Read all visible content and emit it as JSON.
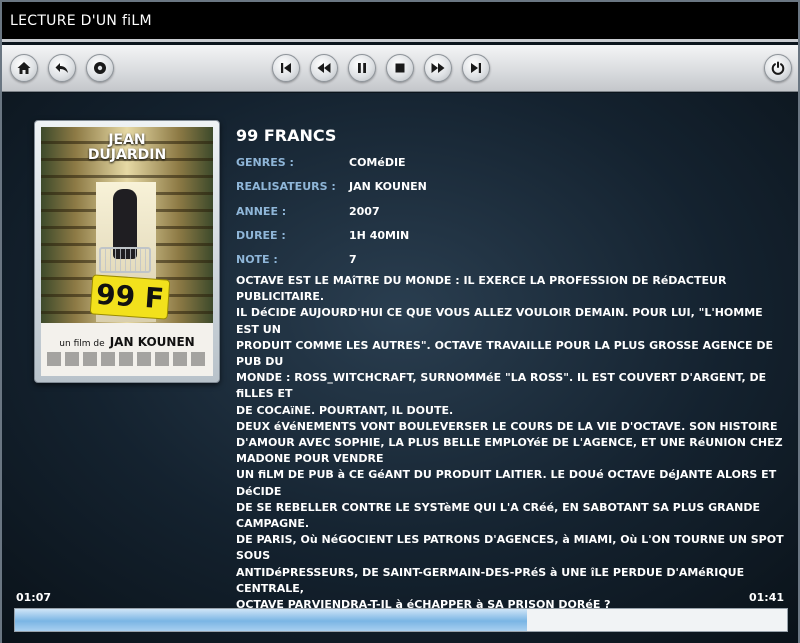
{
  "window": {
    "title": "LECTURE D'UN fiLM"
  },
  "toolbar": {
    "left": [
      {
        "id": "home",
        "icon": "home-icon"
      },
      {
        "id": "back",
        "icon": "back-arrow-icon"
      },
      {
        "id": "record",
        "icon": "disc-icon"
      }
    ],
    "center": [
      {
        "id": "skip-previous",
        "icon": "skip-previous-icon"
      },
      {
        "id": "rewind",
        "icon": "rewind-icon"
      },
      {
        "id": "pause",
        "icon": "pause-icon"
      },
      {
        "id": "stop",
        "icon": "stop-icon"
      },
      {
        "id": "fast-forward",
        "icon": "fast-forward-icon"
      },
      {
        "id": "skip-next",
        "icon": "skip-next-icon"
      }
    ],
    "right": [
      {
        "id": "power",
        "icon": "power-icon"
      }
    ]
  },
  "poster": {
    "actor_line1": "JEAN",
    "actor_line2": "DUJARDIN",
    "sticker": "99 F",
    "credit_prefix": "un film de",
    "director": "JAN KOUNEN"
  },
  "film": {
    "title": "99 FRANCS",
    "details": [
      {
        "label": "GENRES :",
        "value": "COMéDIE"
      },
      {
        "label": "REALISATEURS :",
        "value": "JAN KOUNEN"
      },
      {
        "label": "ANNEE :",
        "value": "2007"
      },
      {
        "label": "DUREE :",
        "value": "1H 40MIN"
      },
      {
        "label": "NOTE :",
        "value": "7"
      }
    ],
    "synopsis": [
      "OCTAVE EST LE MAîTRE DU MONDE : IL EXERCE LA PROFESSION DE RéDACTEUR PUBLICITAIRE.",
      "IL DéCIDE AUJOURD'HUI CE QUE VOUS ALLEZ VOULOIR DEMAIN. POUR LUI, \"L'HOMME EST UN",
      "PRODUIT COMME LES AUTRES\". OCTAVE TRAVAILLE POUR LA PLUS GROSSE AGENCE DE PUB DU",
      "MONDE : ROSS_WITCHCRAFT, SURNOMMéE \"LA ROSS\". IL EST COUVERT D'ARGENT, DE fiLLES ET",
      "DE COCAïNE. POURTANT, IL DOUTE.",
      "DEUX éVéNEMENTS VONT BOULEVERSER LE COURS DE LA VIE D'OCTAVE. SON HISTOIRE",
      "D'AMOUR AVEC SOPHIE, LA PLUS BELLE EMPLOYéE DE L'AGENCE, ET UNE RéUNION CHEZ",
      "MADONE POUR VENDRE",
      "UN fiLM DE PUB à CE GéANT DU PRODUIT LAITIER. LE DOUé OCTAVE DéJANTE ALORS ET DéCIDE",
      "DE SE REBELLER CONTRE LE SYSTèME QUI L'A CRéé, EN SABOTANT SA PLUS GRANDE",
      "CAMPAGNE.",
      "DE PARIS, Où NéGOCIENT LES PATRONS D'AGENCES, à MIAMI, Où L'ON TOURNE UN SPOT SOUS",
      "ANTIDéPRESSEURS, DE SAINT-GERMAIN-DES-PRéS à UNE îLE PERDUE D'AMéRIQUE CENTRALE,",
      "OCTAVE PARVIENDRA-T-IL à éCHAPPER à SA PRISON DORéE ?"
    ]
  },
  "playback": {
    "elapsed": "01:07",
    "total": "01:41",
    "progress_fraction": 0.663
  },
  "colors": {
    "label": "#8fb6d8",
    "text": "#ffffff",
    "progress_fill": "#7ab5e4",
    "background": "#14222f"
  }
}
